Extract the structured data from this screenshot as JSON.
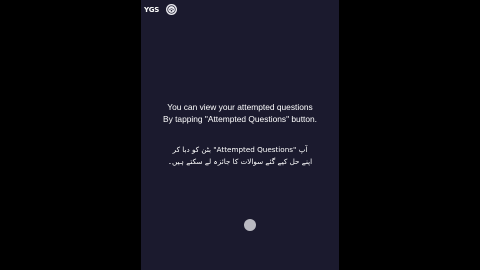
{
  "header": {
    "brand_logo_text": "YGS",
    "emblem_icon": "emblem-icon"
  },
  "message": {
    "english_line1": "You can view your attempted questions",
    "english_line2": "By tapping \"Attempted Questions\" button.",
    "urdu_line1": "آپ \"Attempted Questions\" بٹن کو دبا کر",
    "urdu_line2": "اپنے حل کیے گئے سوالات کا جائزہ لے سکتے ہیں۔"
  },
  "colors": {
    "background": "#1b1a2e",
    "text": "#ffffff",
    "touch_indicator": "#b9b9c1"
  }
}
